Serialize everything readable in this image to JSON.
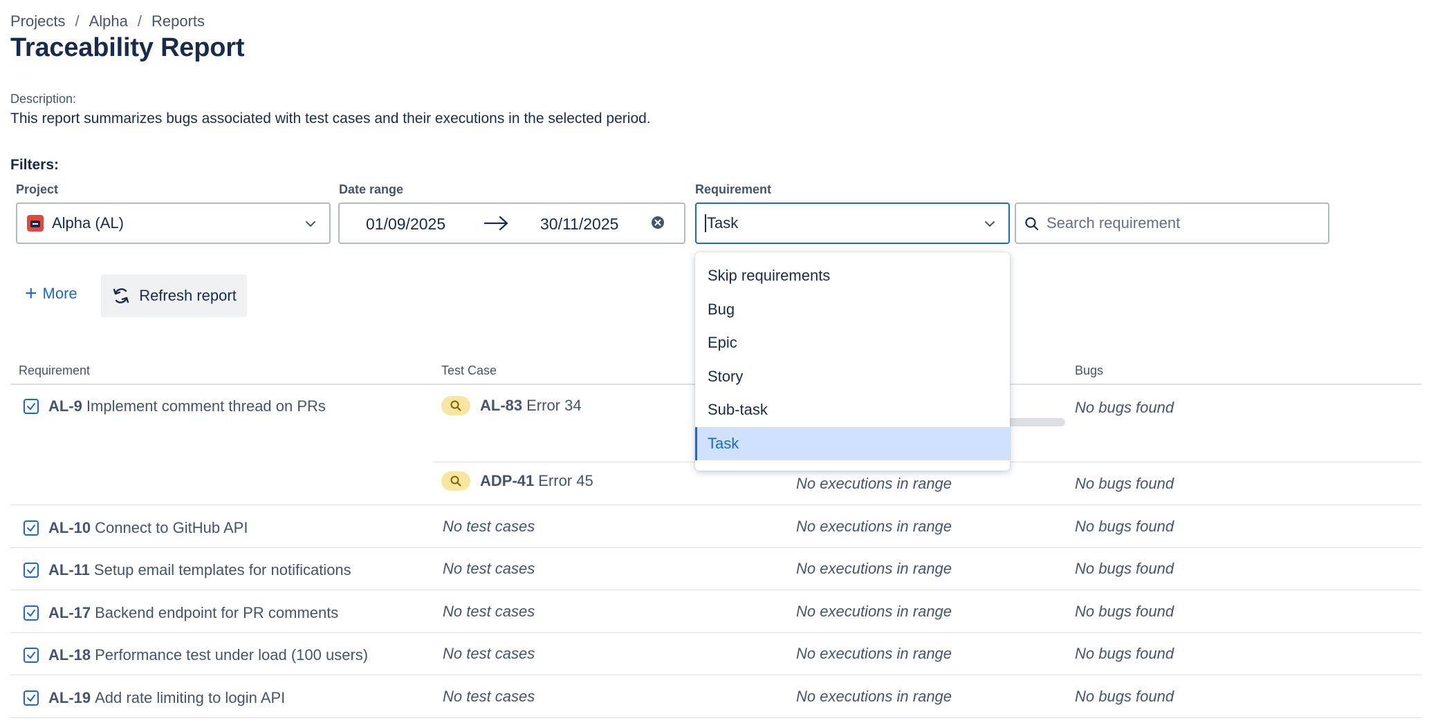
{
  "breadcrumb": [
    "Projects",
    "Alpha",
    "Reports"
  ],
  "page": {
    "title": "Traceability Report",
    "description_label": "Description:",
    "description": "This report summarizes bugs associated with test cases and their executions in the selected period.",
    "filters_label": "Filters:"
  },
  "filters": {
    "project": {
      "label": "Project",
      "value": "Alpha (AL)"
    },
    "date_range": {
      "label": "Date range",
      "start": "01/09/2025",
      "end": "30/11/2025"
    },
    "requirement": {
      "label": "Requirement",
      "value": "Task"
    },
    "search": {
      "placeholder": "Search requirement",
      "value": ""
    }
  },
  "actions": {
    "more": "More",
    "refresh": "Refresh report"
  },
  "dropdown": {
    "options": [
      "Skip requirements",
      "Bug",
      "Epic",
      "Story",
      "Sub-task",
      "Task"
    ],
    "selected": "Task"
  },
  "table": {
    "columns": [
      "Requirement",
      "Test Case",
      "Bugs"
    ],
    "rows": [
      {
        "key": "AL-9",
        "title": "Implement comment thread on PRs",
        "test_cases": [
          {
            "key": "AL-83",
            "title": "Error 34",
            "executions": "",
            "bugs": "No bugs found"
          },
          {
            "key": "ADP-41",
            "title": "Error 45",
            "executions": "No executions in range",
            "bugs": "No bugs found"
          }
        ]
      },
      {
        "key": "AL-10",
        "title": "Connect to GitHub API",
        "test_cases_text": "No test cases",
        "executions": "No executions in range",
        "bugs": "No bugs found"
      },
      {
        "key": "AL-11",
        "title": "Setup email templates for notifications",
        "test_cases_text": "No test cases",
        "executions": "No executions in range",
        "bugs": "No bugs found"
      },
      {
        "key": "AL-17",
        "title": "Backend endpoint for PR comments",
        "test_cases_text": "No test cases",
        "executions": "No executions in range",
        "bugs": "No bugs found"
      },
      {
        "key": "AL-18",
        "title": "Performance test under load (100 users)",
        "test_cases_text": "No test cases",
        "executions": "No executions in range",
        "bugs": "No bugs found"
      },
      {
        "key": "AL-19",
        "title": "Add rate limiting to login API",
        "test_cases_text": "No test cases",
        "executions": "No executions in range",
        "bugs": "No bugs found"
      }
    ]
  },
  "colors": {
    "accent": "#1868db",
    "test_case_badge": "#f8e6a0",
    "selected_option_bg": "#cfe1fd"
  }
}
